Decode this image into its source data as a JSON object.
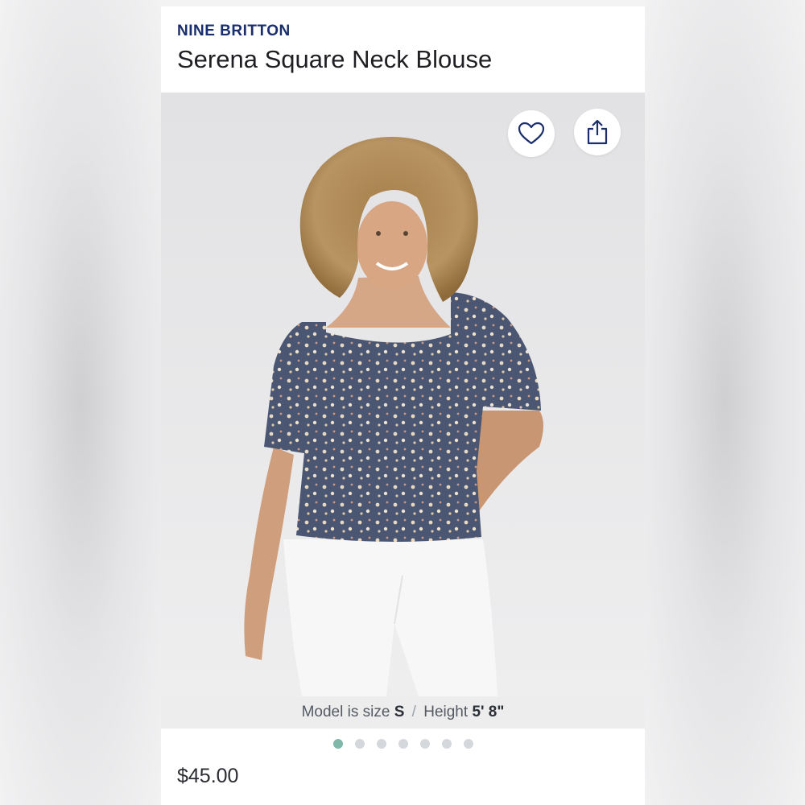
{
  "product": {
    "brand": "NINE BRITTON",
    "title": "Serena Square Neck Blouse",
    "price": "$45.00"
  },
  "actions": {
    "favorite_icon": "heart-icon",
    "share_icon": "share-icon"
  },
  "gallery": {
    "image_count": 7,
    "active_index": 0,
    "caption": {
      "model_prefix": "Model is size",
      "model_size": "S",
      "separator": "/",
      "height_prefix": "Height",
      "height_value": "5' 8\""
    }
  },
  "colors": {
    "brand": "#1a2e6e",
    "active_dot": "#7fb7a9",
    "inactive_dot": "#d4d7db"
  }
}
